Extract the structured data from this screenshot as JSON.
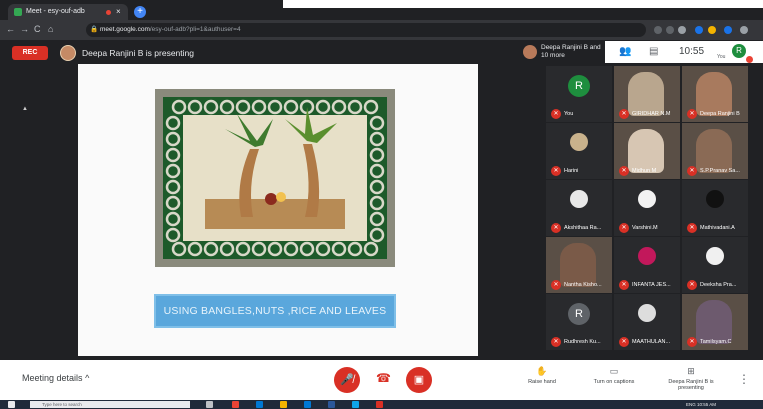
{
  "browser": {
    "tab_title": "Meet - esy-ouf-adb",
    "tab_close": "×",
    "new_tab": "+",
    "url_host": "meet.google.com",
    "url_path": "/esy-ouf-adb?pli=1&authuser=4",
    "back": "←",
    "forward": "→",
    "reload": "C",
    "home": "⌂"
  },
  "meet": {
    "rec_label": "REC",
    "presenting_text": "Deepa Ranjini B is presenting",
    "others_text": "Deepa Ranjini B and 10 more",
    "clock": "10:55",
    "you_label": "You",
    "you_initial": "R",
    "slide_caption": "USING BANGLES,NUTS ,RICE AND LEAVES",
    "participants": [
      {
        "name": "You",
        "initial": "R",
        "color": "#1e8e3e",
        "kind": "letter"
      },
      {
        "name": "GIRIDHAR N.M",
        "kind": "video",
        "color": "#b9a68e"
      },
      {
        "name": "Deepa Ranjini B",
        "kind": "video",
        "color": "#a87a5e"
      },
      {
        "name": "Harini",
        "kind": "pic",
        "color": "#c9b28c"
      },
      {
        "name": "Midhun M",
        "kind": "video",
        "color": "#d7c6b3"
      },
      {
        "name": "S.P.Pranav Sa...",
        "kind": "video",
        "color": "#8a6a55"
      },
      {
        "name": "Akshithaa Ra...",
        "kind": "pic",
        "color": "#e8e8e8"
      },
      {
        "name": "Varshini.M",
        "kind": "pic",
        "color": "#f2f2f2"
      },
      {
        "name": "Mathivadani.A",
        "kind": "pic",
        "color": "#111111"
      },
      {
        "name": "Nantha Kisho...",
        "kind": "video",
        "color": "#7a5a48"
      },
      {
        "name": "INFANTA JES...",
        "kind": "pic",
        "color": "#c2185b"
      },
      {
        "name": "Deeksha Pra...",
        "kind": "pic",
        "color": "#f0f0f0"
      },
      {
        "name": "Rudhresh Ku...",
        "initial": "R",
        "color": "#5f6368",
        "kind": "letter"
      },
      {
        "name": "MAATHULAN...",
        "kind": "pic",
        "color": "#dddddd"
      },
      {
        "name": "Tamilsyam.C",
        "kind": "video",
        "color": "#6d5a6e"
      }
    ]
  },
  "bottombar": {
    "meeting_details": "Meeting details",
    "chevron": "^",
    "raise_hand": "Raise hand",
    "captions": "Turn on captions",
    "presenting": "Deepa Ranjini B is presenting",
    "more": "⋮"
  },
  "taskbar": {
    "search_placeholder": "Type here to search",
    "lang": "ENG",
    "time": "10:55 AM"
  },
  "colors": {
    "meet_bg": "#202124",
    "red": "#d93025",
    "caption_blue": "#5aa7dc"
  }
}
